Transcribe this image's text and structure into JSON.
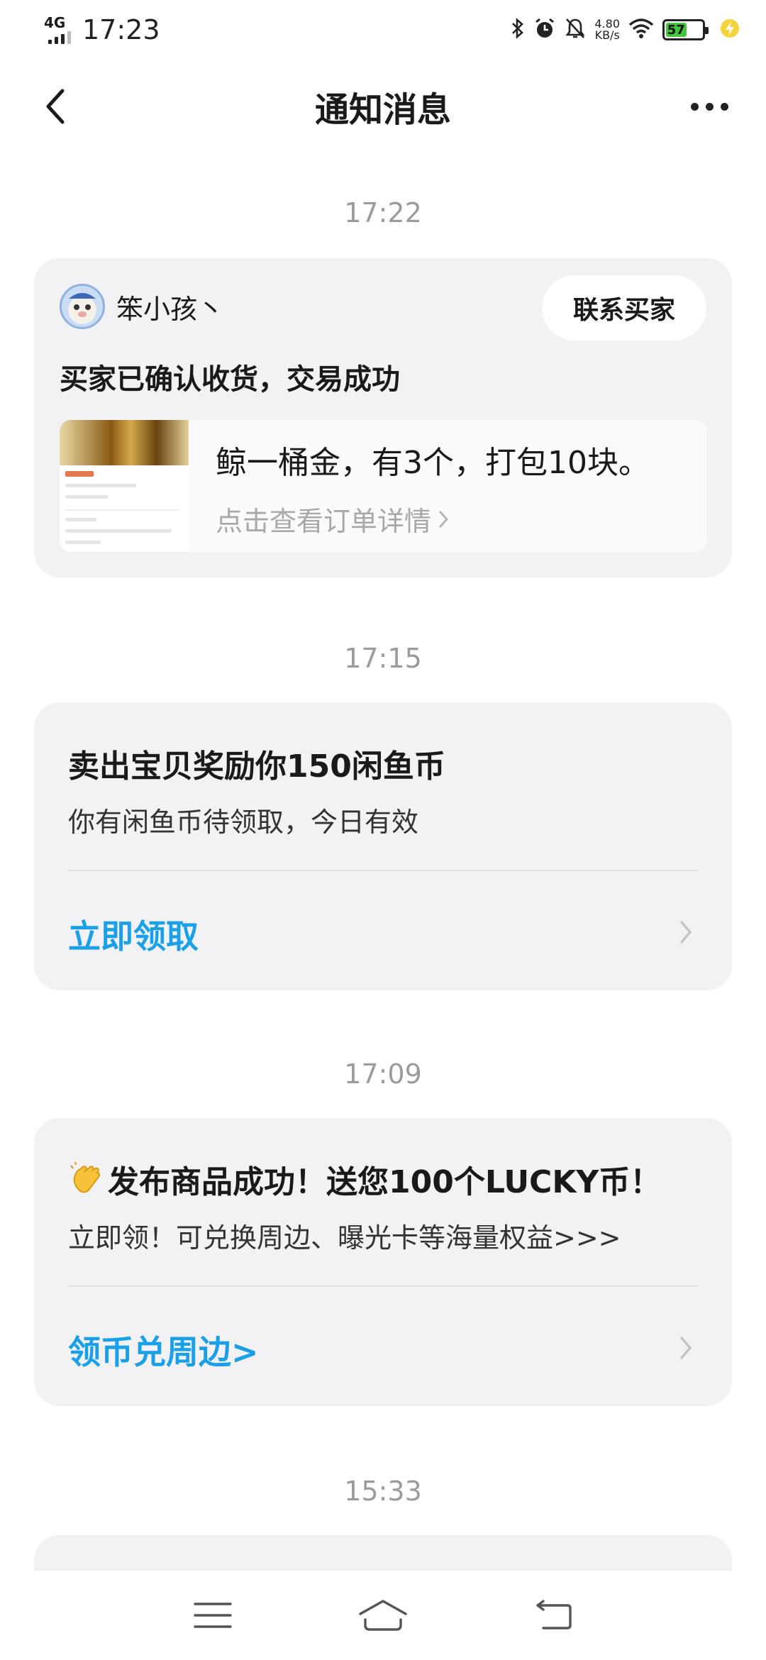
{
  "status_bar": {
    "network": "4G",
    "time": "17:23",
    "speed_value": "4.80",
    "speed_unit": "KB/s",
    "battery": "57",
    "icons": [
      "bluetooth-icon",
      "alarm-icon",
      "mute-icon",
      "wifi-icon",
      "battery-icon",
      "charging-icon"
    ]
  },
  "nav": {
    "title": "通知消息",
    "back_icon": "chevron-left-icon",
    "more_icon": "more-dots-icon"
  },
  "messages": [
    {
      "time": "17:22",
      "user": "笨小孩丶",
      "contact_label": "联系买家",
      "title": "买家已确认收货，交易成功",
      "order_desc": "鲸一桶金，有3个，打包10块。",
      "order_link": "点击查看订单详情"
    },
    {
      "time": "17:15",
      "title": "卖出宝贝奖励你150闲鱼币",
      "subtitle": "你有闲鱼币待领取，今日有效",
      "action": "立即领取"
    },
    {
      "time": "17:09",
      "emoji_icon": "clapping-hands-icon",
      "title": "发布商品成功！送您100个LUCKY币！",
      "subtitle": "立即领！可兑换周边、曝光卡等海量权益>>>",
      "action": "领币兑周边>"
    },
    {
      "time": "15:33"
    }
  ],
  "colors": {
    "accent": "#1aa0e8",
    "card_bg": "#f2f2f4",
    "timestamp": "#9b9b9b"
  }
}
